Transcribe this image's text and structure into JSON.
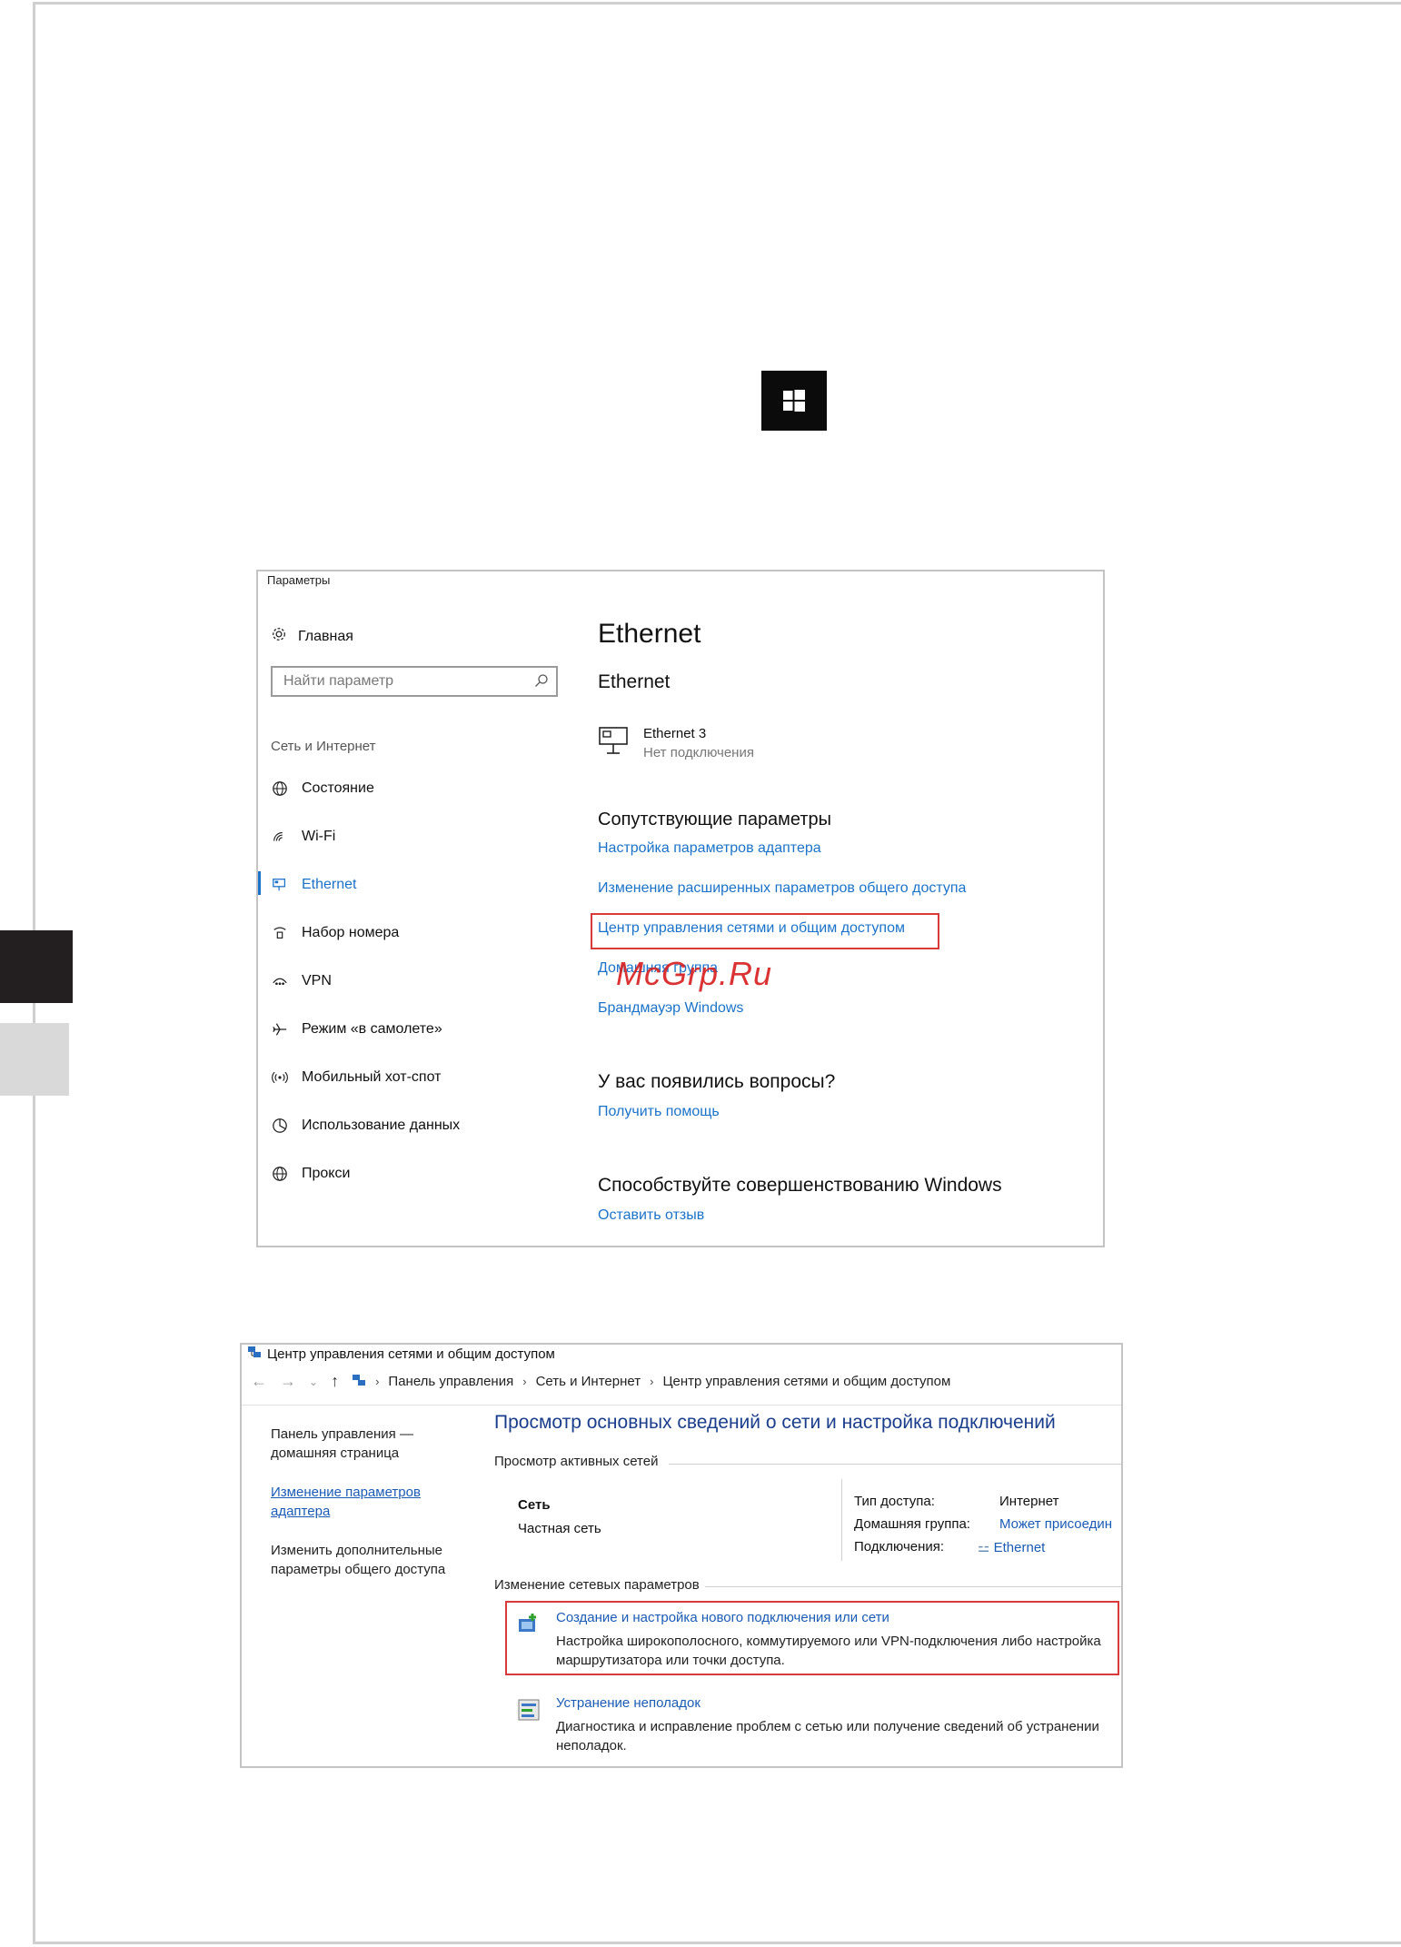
{
  "settings": {
    "window_title": "Параметры",
    "home": "Главная",
    "search_placeholder": "Найти параметр",
    "section": "Сеть и Интернет",
    "nav": [
      {
        "label": "Состояние",
        "icon": "globe-icon"
      },
      {
        "label": "Wi-Fi",
        "icon": "wifi-icon"
      },
      {
        "label": "Ethernet",
        "icon": "ethernet-icon"
      },
      {
        "label": "Набор номера",
        "icon": "dialup-icon"
      },
      {
        "label": "VPN",
        "icon": "vpn-icon"
      },
      {
        "label": "Режим «в самолете»",
        "icon": "airplane-icon"
      },
      {
        "label": "Мобильный хот-спот",
        "icon": "hotspot-icon"
      },
      {
        "label": "Использование данных",
        "icon": "data-usage-icon"
      },
      {
        "label": "Прокси",
        "icon": "proxy-globe-icon"
      }
    ],
    "page_title": "Ethernet",
    "subtitle": "Ethernet",
    "connection": {
      "name": "Ethernet 3",
      "status": "Нет подключения"
    },
    "related_heading": "Сопутствующие параметры",
    "related_links": [
      "Настройка параметров адаптера",
      "Изменение расширенных параметров общего доступа",
      "Центр управления сетями и общим доступом",
      "Домашняя группа",
      "Брандмауэр Windows"
    ],
    "questions_heading": "У вас появились вопросы?",
    "help_link": "Получить помощь",
    "improve_heading": "Способствуйте совершенствованию Windows",
    "feedback_link": "Оставить отзыв"
  },
  "watermark": "McGrp.Ru",
  "nsc": {
    "window_title": "Центр управления сетями и общим доступом",
    "breadcrumb": [
      "Панель управления",
      "Сеть и Интернет",
      "Центр управления сетями и общим доступом"
    ],
    "left_pane": {
      "home": "Панель управления — домашняя страница",
      "adapter": "Изменение параметров адаптера",
      "sharing": "Изменить дополнительные параметры общего доступа"
    },
    "main_heading": "Просмотр основных сведений о сети и настройка подключений",
    "active_networks": "Просмотр активных сетей",
    "network_name": "Сеть",
    "network_type": "Частная сеть",
    "access_type_label": "Тип доступа:",
    "access_type_value": "Интернет",
    "homegroup_label": "Домашняя группа:",
    "homegroup_value": "Может присоедин",
    "connections_label": "Подключения:",
    "connections_value": "Ethernet",
    "change_settings": "Изменение сетевых параметров",
    "task1_link": "Создание и настройка нового подключения или сети",
    "task1_desc": "Настройка широкополосного, коммутируемого или VPN-подключения либо настройка маршрутизатора или точки доступа.",
    "task2_link": "Устранение неполадок",
    "task2_desc": "Диагностика и исправление проблем с сетью или получение сведений об устранении неполадок."
  },
  "colors": {
    "link": "#1a73c9",
    "highlight_box": "#d83a3a",
    "watermark": "#d81e1e"
  }
}
